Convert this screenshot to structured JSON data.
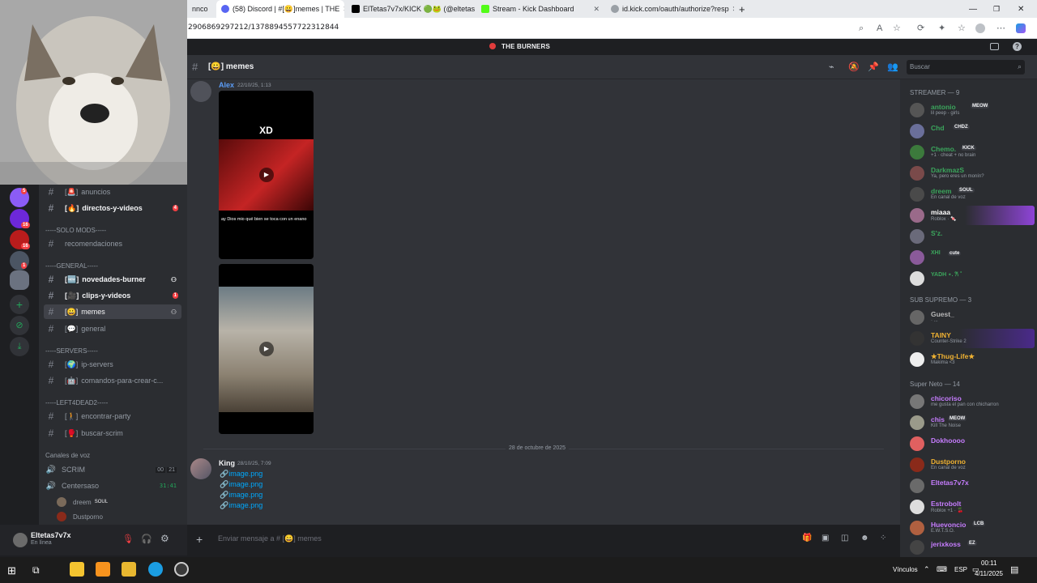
{
  "browser": {
    "tabs": [
      {
        "label": "nnco"
      },
      {
        "label": "(58) Discord | #[😀]memes | THE",
        "active": true
      },
      {
        "label": "ElTetas7v7x/KICK 🟢🐸 (@eltetas"
      },
      {
        "label": "Stream - Kick Dashboard"
      },
      {
        "label": "id.kick.com/oauth/authorize?resp"
      }
    ],
    "url": "2906869297212/1378894557722312844"
  },
  "server": {
    "name": "THE BURNERS"
  },
  "channels": {
    "items": [
      {
        "emoji": "[🚨]",
        "name": "anuncios"
      },
      {
        "emoji": "[🔥]",
        "name": "directos-y-videos",
        "badge": "4"
      },
      {
        "name": "recomendaciones"
      },
      {
        "emoji": "[🆕]",
        "name": "novedades-burner"
      },
      {
        "emoji": "[🎥]",
        "name": "clips-y-videos",
        "badge": "1"
      },
      {
        "emoji": "[😀]",
        "name": "memes"
      },
      {
        "emoji": "[💬]",
        "name": "general"
      },
      {
        "emoji": "[🌍]",
        "name": "ip-servers"
      },
      {
        "emoji": "[🤖]",
        "name": "comandos-para-crear-c..."
      },
      {
        "emoji": "[🚶]",
        "name": "encontrar-party"
      },
      {
        "emoji": "[🥊]",
        "name": "buscar-scrim"
      }
    ],
    "categories": [
      "-----SOLO MODS-----",
      "-----GENERAL-----",
      "-----SERVERS-----",
      "-----LEFT4DEAD2-----",
      "Canales de voz"
    ],
    "voice": [
      {
        "name": "SCRIM",
        "count": "00",
        "count2": "21"
      },
      {
        "name": "Centersaso",
        "time": "31:41"
      }
    ],
    "voice_users": [
      {
        "name": "dreem",
        "tag": "SOUL"
      },
      {
        "name": "Dustporno"
      }
    ]
  },
  "user": {
    "name": "Eltetas7v7x",
    "status": "En línea"
  },
  "chat": {
    "channel": "[😀] memes",
    "search_placeholder": "Buscar",
    "messages": [
      {
        "author": "Alex",
        "time": "22/10/25, 1:13",
        "video1_caption": "XD",
        "video1_sub": "ay Dios mio qué bien se toca con un enano"
      },
      {
        "author": "King",
        "time": "28/10/25, 7:09",
        "attachments": [
          "image.png",
          "image.png",
          "image.png",
          "image.png"
        ]
      }
    ],
    "date_divider": "28 de octubre de 2025",
    "composer_placeholder": "Enviar mensaje a # [😀] memes"
  },
  "members": {
    "sections": [
      {
        "title": "STREAMER — 9"
      },
      {
        "title": "SUB SUPREMO — 3"
      },
      {
        "title": "Super Neto — 14"
      }
    ],
    "list": [
      {
        "name": "antonio",
        "tag": "MEOW",
        "status": "lil peep - girls",
        "color": "#3ba55c"
      },
      {
        "name": "Chd",
        "tag": "CHDZ",
        "status": "",
        "color": "#3ba55c"
      },
      {
        "name": "Chemo.",
        "tag": "KICK",
        "status": "+1 · cheat + no brain",
        "color": "#3ba55c"
      },
      {
        "name": "DarkmazS",
        "tag": "",
        "status": "Ya, pero eres un monín?",
        "color": "#3ba55c"
      },
      {
        "name": "dreem",
        "tag": "SOUL",
        "status": "En canal de voz",
        "color": "#3ba55c"
      },
      {
        "name": "miaaa",
        "tag": "",
        "status": "Roblox · 🍬",
        "color": "#ffffff"
      },
      {
        "name": "S'z.",
        "tag": "",
        "status": "",
        "color": "#3ba55c"
      },
      {
        "name": "XHI",
        "tag": "cute",
        "status": "",
        "color": "#3ba55c"
      },
      {
        "name": "YADH ⋆. 𐙚 ˚",
        "tag": "",
        "status": "",
        "color": "#3ba55c"
      },
      {
        "name": "Guest_",
        "tag": "",
        "status": "· ...",
        "color": "#b8b8b8"
      },
      {
        "name": "TAINY",
        "tag": "",
        "status": "Counter-Strike 2",
        "color": "#f0b232"
      },
      {
        "name": "★Thug-Life★",
        "tag": "",
        "status": "Makima <3",
        "color": "#f0b232"
      },
      {
        "name": "chicoriso",
        "tag": "",
        "status": "me gusta el pan con chicharron",
        "color": "#c77dff"
      },
      {
        "name": "chis",
        "tag": "MEOW",
        "status": "Kill The Noise",
        "color": "#c77dff"
      },
      {
        "name": "Dokhoooo",
        "tag": "",
        "status": "",
        "color": "#c77dff"
      },
      {
        "name": "Dustporno",
        "tag": "",
        "status": "En canal de voz",
        "color": "#f0b232"
      },
      {
        "name": "Eltetas7v7x",
        "tag": "",
        "status": "",
        "color": "#c77dff"
      },
      {
        "name": "Estrobolt",
        "tag": "",
        "status": "Roblox +1 · 🍒",
        "color": "#c77dff"
      },
      {
        "name": "Huevoncio",
        "tag": "LCB",
        "status": "E.W.T.S.O.",
        "color": "#c77dff"
      },
      {
        "name": "jerixkoss",
        "tag": "EZ",
        "status": "",
        "color": "#c77dff"
      }
    ]
  },
  "taskbar": {
    "links": "Vínculos",
    "lang": "ESP",
    "time": "00:11",
    "date": "4/11/2025"
  }
}
